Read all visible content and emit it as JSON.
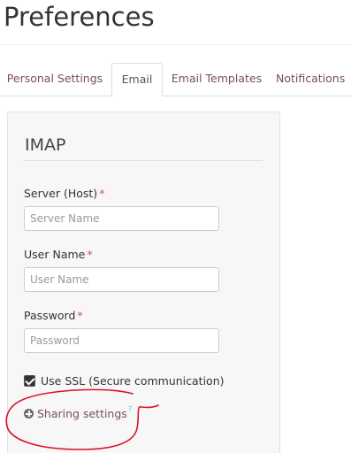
{
  "page": {
    "title": "Preferences"
  },
  "tabs": [
    {
      "label": "Personal Settings",
      "active": false
    },
    {
      "label": "Email",
      "active": true
    },
    {
      "label": "Email Templates",
      "active": false
    },
    {
      "label": "Notifications",
      "active": false
    }
  ],
  "imap": {
    "section_title": "IMAP",
    "server": {
      "label": "Server (Host)",
      "required_mark": "*",
      "placeholder": "Server Name",
      "value": ""
    },
    "username": {
      "label": "User Name",
      "required_mark": "*",
      "placeholder": "User Name",
      "value": ""
    },
    "password": {
      "label": "Password",
      "required_mark": "*",
      "placeholder": "Password",
      "value": ""
    },
    "ssl": {
      "label": "Use SSL (Secure communication)",
      "checked": true
    },
    "sharing": {
      "label": "Sharing settings",
      "help_mark": "?"
    }
  },
  "colors": {
    "link": "#7a4b6b",
    "annotation": "#e0102a",
    "required": "#d9534f"
  },
  "icons": {
    "sharing": "plus-circle-icon",
    "ssl": "checkbox-checked-icon"
  }
}
